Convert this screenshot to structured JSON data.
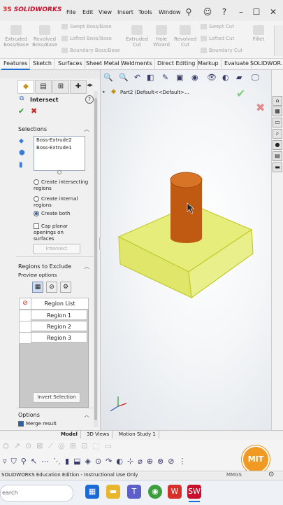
{
  "app": {
    "name": "SOLIDWORKS",
    "menus": [
      "File",
      "Edit",
      "View",
      "Insert",
      "Tools",
      "Window"
    ]
  },
  "command_manager": {
    "extruded_boss": "Extruded Boss/Base",
    "revolved_boss": "Revolved Boss/Base",
    "swept_boss": "Swept Boss/Base",
    "lofted_boss": "Lofted Boss/Base",
    "boundary_boss": "Boundary Boss/Base",
    "extruded_cut": "Extruded Cut",
    "hole_wizard": "Hole Wizard",
    "revolved_cut": "Revolved Cut",
    "swept_cut": "Swept Cut",
    "lofted_cut": "Lofted Cut",
    "boundary_cut": "Boundary Cut",
    "fillet": "Fillet"
  },
  "tabs": [
    "Features",
    "Sketch",
    "Surfaces",
    "Sheet Metal",
    "Weldments",
    "Direct Editing",
    "Markup",
    "Evaluate",
    "SOLIDWOR..."
  ],
  "property_manager": {
    "title": "Intersect",
    "help": "?",
    "selections_label": "Selections",
    "selections": [
      "Boss-Extrude2",
      "Boss-Extrude1"
    ],
    "options": {
      "create_intersecting": "Create intersecting regions",
      "create_internal": "Create internal regions",
      "create_both": "Create both",
      "selected": "create_both",
      "cap_planar": "Cap planar openings on surfaces",
      "cap_checked": false
    },
    "intersect_button": "Intersect",
    "regions_label": "Regions to Exclude",
    "preview_label": "Preview options",
    "region_list_header": "Region List",
    "regions": [
      "Region 1",
      "Region 2",
      "Region 3"
    ],
    "invert_button": "Invert Selection",
    "options_label": "Options",
    "merge_result": "Merge result",
    "merge_checked": true
  },
  "graphics": {
    "tree_item": "Part2  (Default<<Default>...",
    "block_color": "#e6ed7a",
    "cylinder_color": "#c05a13"
  },
  "bottom_tabs": [
    "Model",
    "3D Views",
    "Motion Study 1"
  ],
  "status": {
    "left": "SOLIDWORKS Education Edition - Instructional Use Only",
    "right": "MMGS"
  },
  "taskbar": {
    "search_placeholder": "earch"
  }
}
